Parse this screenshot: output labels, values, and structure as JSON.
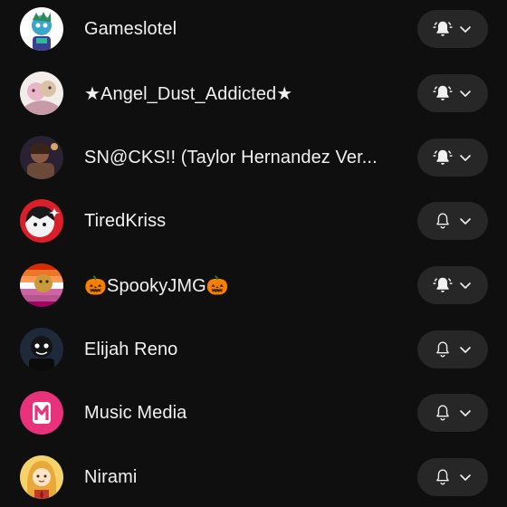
{
  "channels": [
    {
      "name": "Gameslotel",
      "bell": "all",
      "avatar_color": "#3aa7c9"
    },
    {
      "name": "★Angel_Dust_Addicted★",
      "bell": "all",
      "avatar_color": "#e8b6c6"
    },
    {
      "name": "SN@CKS!! (Taylor Hernandez Ver...",
      "bell": "all",
      "avatar_color": "#6b4a3a"
    },
    {
      "name": "TiredKriss",
      "bell": "none",
      "avatar_color": "#d81f2a"
    },
    {
      "name": "🎃SpookyJMG🎃",
      "bell": "all",
      "avatar_color": "#d6572e"
    },
    {
      "name": "Elijah Reno",
      "bell": "none",
      "avatar_color": "#1e2a3a"
    },
    {
      "name": "Music Media",
      "bell": "none",
      "avatar_color": "#e8327c"
    },
    {
      "name": "Nirami",
      "bell": "none",
      "avatar_color": "#c0392b"
    }
  ],
  "icons": {
    "bell_all": "bell-ringing-icon",
    "bell_none": "bell-outline-icon",
    "chevron": "chevron-down-icon"
  }
}
